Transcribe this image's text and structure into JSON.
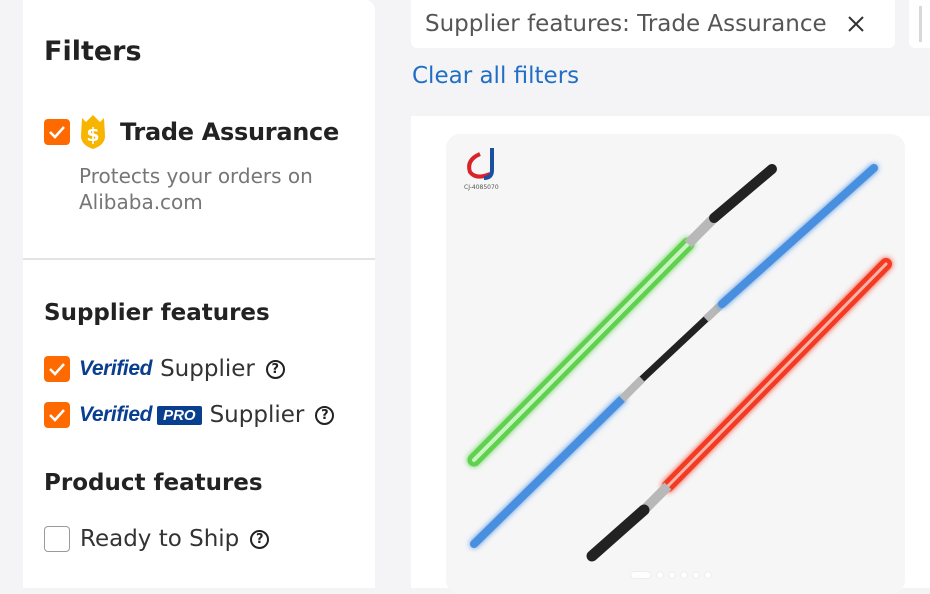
{
  "sidebar": {
    "title": "Filters",
    "trade_assurance": {
      "checked": true,
      "label": "Trade Assurance",
      "description": "Protects your orders on Alibaba.com",
      "icon": "dollar-shield-icon"
    },
    "supplier_features": {
      "title": "Supplier features",
      "items": [
        {
          "badge_word": "Verified",
          "badge_pro": "",
          "label": "Supplier",
          "checked": true
        },
        {
          "badge_word": "Verified",
          "badge_pro": "PRO",
          "label": "Supplier",
          "checked": true
        }
      ]
    },
    "product_features": {
      "title": "Product features",
      "items": [
        {
          "label": "Ready to Ship",
          "checked": false
        }
      ]
    },
    "help_glyph": "?"
  },
  "active_filters": {
    "chip_text": "Supplier features: Trade Assurance",
    "clear_all": "Clear all filters"
  },
  "product": {
    "logo_text": "CJ-4085070",
    "image_description_icon": "lightsaber-toy-image",
    "carousel": {
      "count": 6,
      "active": 0
    }
  },
  "colors": {
    "checkbox": "#ff6a00",
    "link": "#1f6fc5",
    "verified": "#0a3f8f"
  }
}
